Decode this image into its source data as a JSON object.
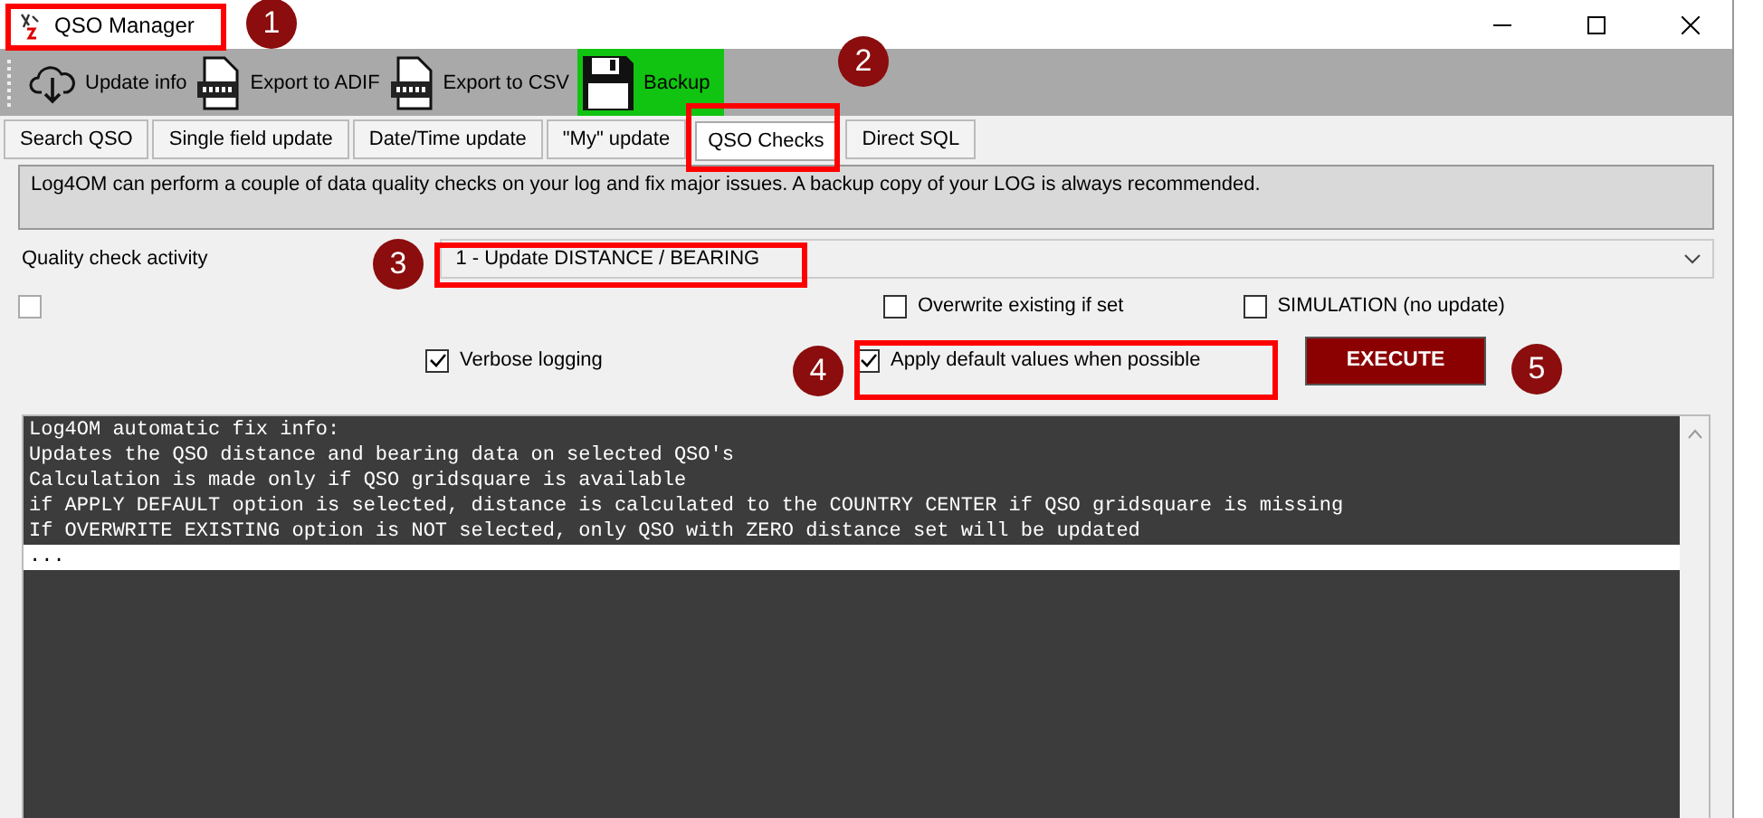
{
  "window": {
    "title": "QSO Manager"
  },
  "toolbar": [
    {
      "kind": "cloud",
      "label": "Update info",
      "selected": false
    },
    {
      "kind": "adif",
      "label": "Export to ADIF",
      "selected": false
    },
    {
      "kind": "csv",
      "label": "Export to CSV",
      "selected": false
    },
    {
      "kind": "floppy",
      "label": "Backup",
      "selected": true
    }
  ],
  "tabs": [
    {
      "label": "Search QSO",
      "selected": false
    },
    {
      "label": "Single field update",
      "selected": false
    },
    {
      "label": "Date/Time update",
      "selected": false
    },
    {
      "label": "\"My\" update",
      "selected": false
    },
    {
      "label": "QSO Checks",
      "selected": true
    },
    {
      "label": "Direct SQL",
      "selected": false
    }
  ],
  "info": "Log4OM can perform a couple of data quality checks on your log and fix major issues. A backup copy of your LOG is always recommended.",
  "activity": {
    "label": "Quality check activity",
    "value": "1 - Update DISTANCE / BEARING"
  },
  "options": {
    "blank_checked": false,
    "overwrite": {
      "label": "Overwrite existing if set",
      "checked": false
    },
    "simulation": {
      "label": "SIMULATION (no update)",
      "checked": false
    },
    "verbose": {
      "label": "Verbose logging",
      "checked": true
    },
    "apply_default": {
      "label": "Apply default values when possible",
      "checked": true
    }
  },
  "execute_button": "EXECUTE",
  "log": [
    {
      "text": "Log4OM automatic fix info:",
      "selected": false
    },
    {
      "text": "Updates the QSO distance and bearing data on selected QSO's",
      "selected": false
    },
    {
      "text": "Calculation is made only if QSO gridsquare is available",
      "selected": false
    },
    {
      "text": "if APPLY DEFAULT option is selected, distance is calculated to the COUNTRY CENTER if QSO gridsquare is missing",
      "selected": false
    },
    {
      "text": "If OVERWRITE EXISTING option is NOT selected, only QSO with ZERO distance set will be updated",
      "selected": false
    },
    {
      "text": "...",
      "selected": true
    }
  ],
  "callouts": [
    {
      "label": "1",
      "framed": true
    },
    {
      "label": "2",
      "framed": true
    },
    {
      "label": "3",
      "framed": true
    },
    {
      "label": "4",
      "framed": true
    },
    {
      "label": "5",
      "framed": false
    }
  ]
}
